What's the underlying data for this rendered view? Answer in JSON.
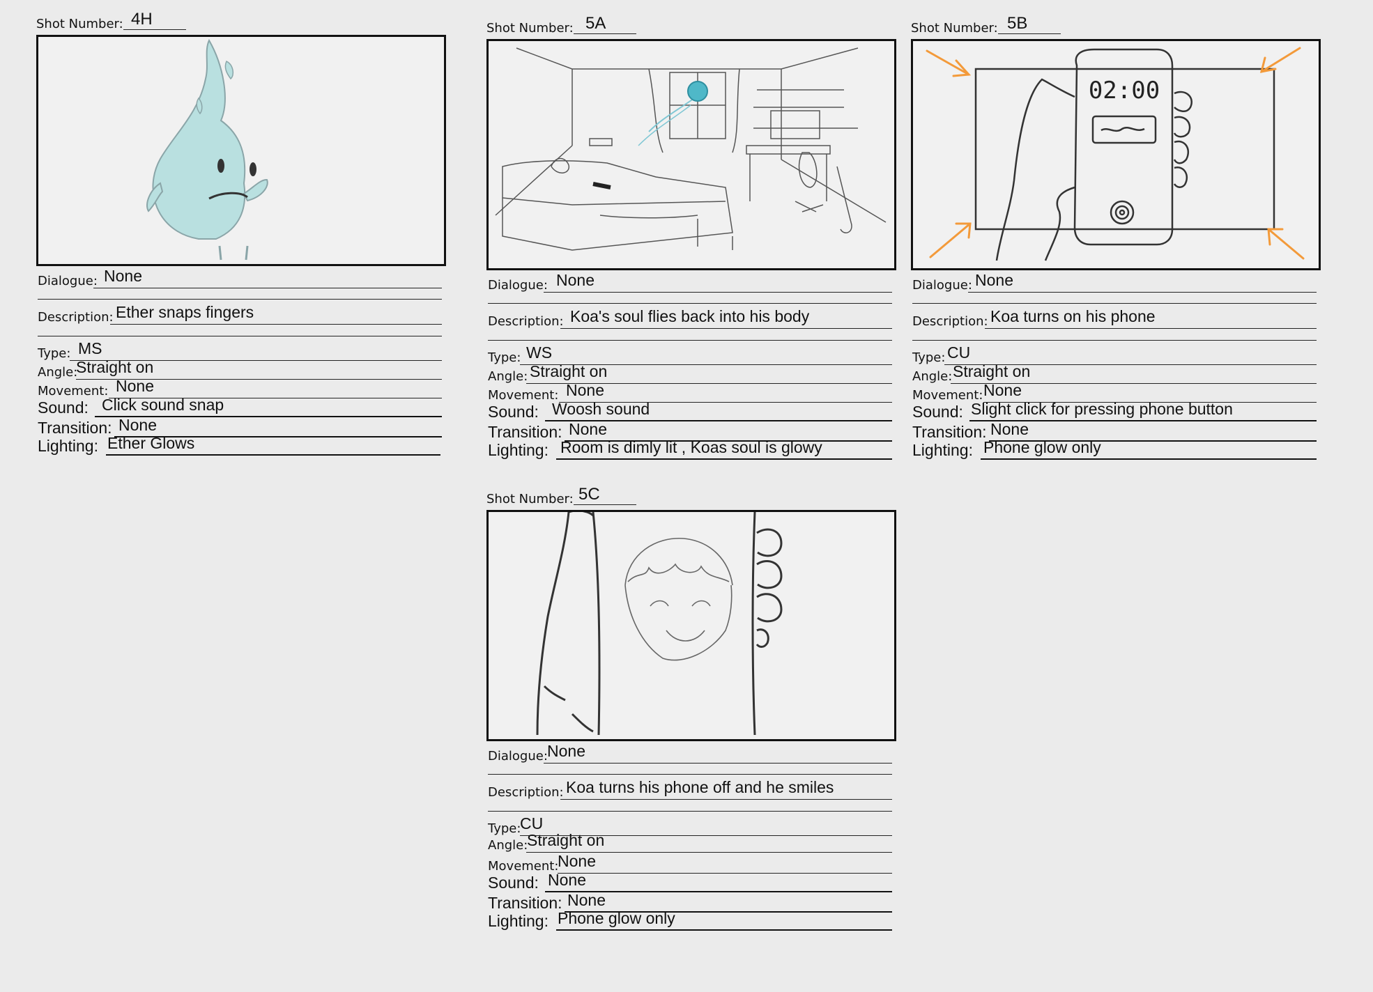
{
  "panels": [
    {
      "shot_label": "Shot Number:",
      "shot_number": "4H",
      "dialogue_label": "Dialogue:",
      "dialogue": "None",
      "description_label": "Description:",
      "description": "Ether snaps fingers",
      "type_label": "Type:",
      "type": "MS",
      "angle_label": "Angle:",
      "angle": "Straight on",
      "movement_label": "Movement:",
      "movement": "None",
      "sound_label": "Sound:",
      "sound": "Click sound snap",
      "transition_label": "Transition:",
      "transition": "None",
      "lighting_label": "Lighting:",
      "lighting": "Ether Glows",
      "sketch": "blue-flame-spirit-character"
    },
    {
      "shot_label": "Shot Number:",
      "shot_number": "5A",
      "dialogue_label": "Dialogue:",
      "dialogue": "None",
      "description_label": "Description:",
      "description": "Koa's soul flies back into his body",
      "type_label": "Type:",
      "type": "WS",
      "angle_label": "Angle:",
      "angle": "Straight on",
      "movement_label": "Movement:",
      "movement": "None",
      "sound_label": "Sound:",
      "sound": "Woosh sound",
      "transition_label": "Transition:",
      "transition": "None",
      "lighting_label": "Lighting:",
      "lighting": "Room is dimly lit , Koas soul is glowy",
      "sketch": "bedroom-wide-shot"
    },
    {
      "shot_label": "Shot Number:",
      "shot_number": "5B",
      "dialogue_label": "Dialogue:",
      "dialogue": "None",
      "description_label": "Description:",
      "description": "Koa turns on his phone",
      "type_label": "Type:",
      "type": "CU",
      "angle_label": "Angle:",
      "angle": "Straight on",
      "movement_label": "Movement:",
      "movement": "None",
      "sound_label": "Sound:",
      "sound": "Slight click for pressing phone button",
      "transition_label": "Transition:",
      "transition": "None",
      "lighting_label": "Lighting:",
      "lighting": "Phone glow only",
      "sketch": "hand-holding-phone",
      "phone_clock": "02:00",
      "accent_color": "#f39a3a"
    },
    {
      "shot_label": "Shot Number:",
      "shot_number": "5C",
      "dialogue_label": "Dialogue:",
      "dialogue": "None",
      "description_label": "Description:",
      "description": "Koa turns his phone off and he smiles",
      "type_label": "Type:",
      "type": "CU",
      "angle_label": "Angle:",
      "angle": "Straight on",
      "movement_label": "Movement:",
      "movement": "None",
      "sound_label": "Sound:",
      "sound": "None",
      "transition_label": "Transition:",
      "transition": "None",
      "lighting_label": "Lighting:",
      "lighting": "Phone glow only",
      "sketch": "smiling-face-through-fingers"
    }
  ]
}
